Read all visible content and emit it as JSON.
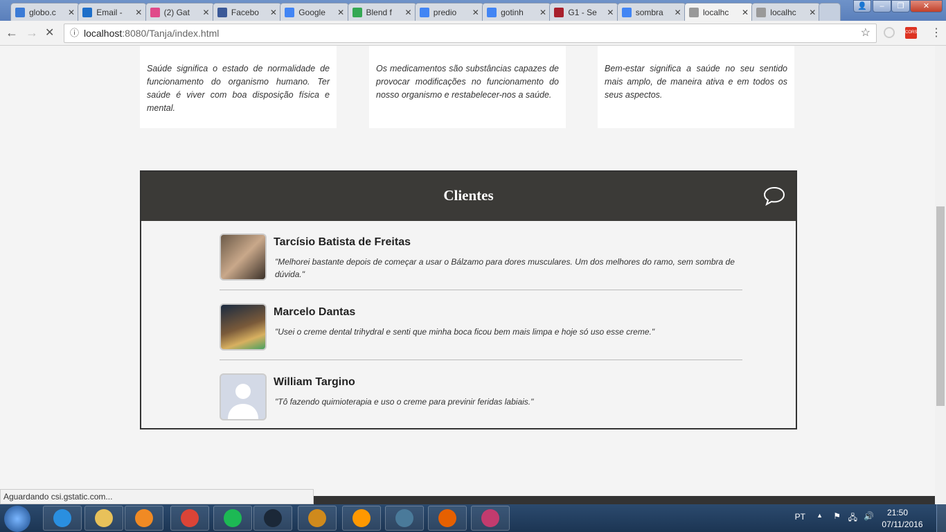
{
  "browser": {
    "tabs": [
      {
        "title": "globo.c",
        "icon": "globo-icon",
        "color": "#3b7bd6"
      },
      {
        "title": "Email -",
        "icon": "outlook-icon",
        "color": "#1e6fc9"
      },
      {
        "title": "(2) Gat",
        "icon": "gatry-icon",
        "color": "#e04a8a"
      },
      {
        "title": "Facebo",
        "icon": "facebook-icon",
        "color": "#3b5998"
      },
      {
        "title": "Google",
        "icon": "google-icon",
        "color": "#4285f4"
      },
      {
        "title": "Blend f",
        "icon": "maps-icon",
        "color": "#34a853"
      },
      {
        "title": "predio",
        "icon": "google-icon",
        "color": "#4285f4"
      },
      {
        "title": "gotinh",
        "icon": "google-icon",
        "color": "#4285f4"
      },
      {
        "title": "G1 - Se",
        "icon": "g1-icon",
        "color": "#a8202c"
      },
      {
        "title": "sombra",
        "icon": "google-icon",
        "color": "#4285f4"
      },
      {
        "title": "localhc",
        "icon": "loading-icon",
        "color": "#999999",
        "active": true
      },
      {
        "title": "localhc",
        "icon": "document-icon",
        "color": "#999999"
      }
    ],
    "url_host": "localhost",
    "url_rest": ":8080/Tanja/index.html",
    "extension_label": "CORS"
  },
  "cards": [
    "Saúde significa o estado de normalidade de funcionamento do organismo humano. Ter saúde é viver com boa disposição física e mental.",
    "Os medicamentos são substâncias capazes de provocar modificações no funcionamento do nosso organismo e restabelecer-nos a saúde.",
    "Bem-estar significa a saúde no seu sentido mais amplo, de maneira ativa e em todos os seus aspectos."
  ],
  "clients": {
    "title": "Clientes",
    "items": [
      {
        "name": "Tarcísio Batista de Freitas",
        "quote": "\"Melhorei bastante depois de começar a usar o Bálzamo para dores musculares. Um dos melhores do ramo, sem sombra de dúvida.\""
      },
      {
        "name": "Marcelo Dantas",
        "quote": "\"Usei o creme dental trihydral e senti que minha boca ficou bem mais limpa e hoje só uso esse creme.\""
      },
      {
        "name": "William Targino",
        "quote": "\"Tô fazendo quimioterapia e uso o creme para previnir feridas labiais.\""
      }
    ]
  },
  "status": "Aguardando csi.gstatic.com...",
  "taskbar": {
    "lang": "PT",
    "time": "21:50",
    "date": "07/11/2016",
    "apps": [
      {
        "icon": "ie-icon",
        "color": "#2a8fe0"
      },
      {
        "icon": "explorer-icon",
        "color": "#e8c15a"
      },
      {
        "icon": "media-player-icon",
        "color": "#f08a24"
      },
      {
        "icon": "chrome-icon",
        "color": "#db4437"
      },
      {
        "icon": "spotify-icon",
        "color": "#1db954"
      },
      {
        "icon": "steam-icon",
        "color": "#1b2838"
      },
      {
        "icon": "csgo-icon",
        "color": "#d08a1c"
      },
      {
        "icon": "sublime-icon",
        "color": "#ff9800"
      },
      {
        "icon": "window-icon",
        "color": "#4a7a9a"
      },
      {
        "icon": "firefox-icon",
        "color": "#e66000"
      },
      {
        "icon": "intellij-icon",
        "color": "#c23b6e"
      }
    ]
  }
}
